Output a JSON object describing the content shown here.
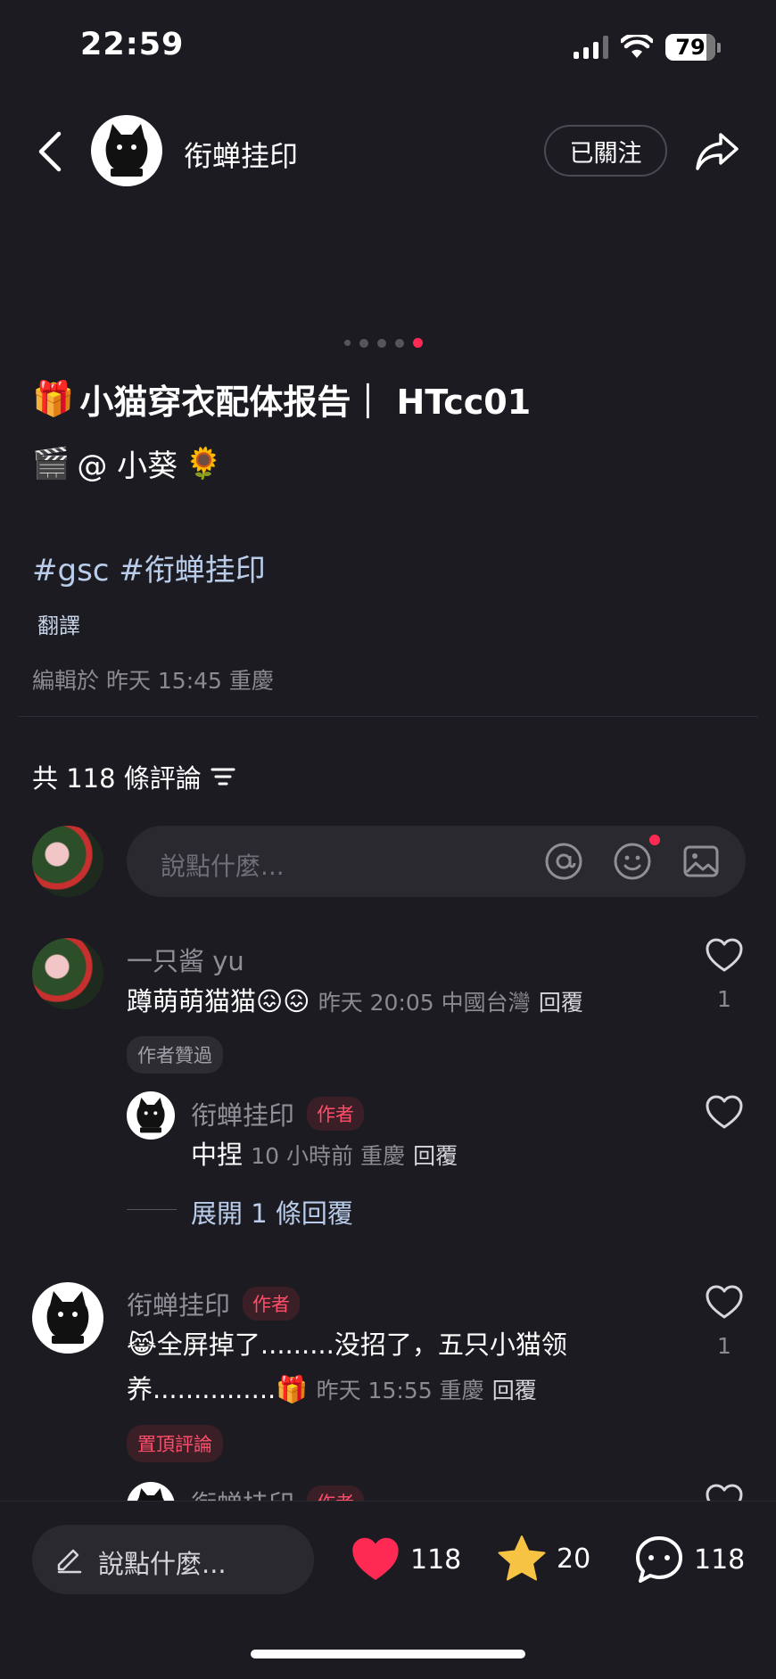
{
  "status_bar": {
    "time": "22:59",
    "battery": "79"
  },
  "header": {
    "account_name": "衔蝉挂印",
    "follow_label": "已關注"
  },
  "post": {
    "title_emoji": "🎁",
    "title": "小猫穿衣配体报告｜ HTcc01",
    "credit_emoji": "🎬",
    "credit": "@ 小葵",
    "credit_end_emoji": "🌻",
    "hashtags": "#gsc #衔蝉挂印",
    "translate_label": "翻譯",
    "edited": "編輯於 昨天 15:45 重慶"
  },
  "comments_header": {
    "title": "共 118 條評論"
  },
  "comment_input": {
    "placeholder": "說點什麼..."
  },
  "comments": [
    {
      "name": "一只酱 yu",
      "text": "蹲萌萌猫猫",
      "emoji": "😖😖",
      "meta": "昨天 20:05 中國台灣",
      "reply": "回覆",
      "tag": "作者贊過",
      "likes": "1"
    },
    {
      "name": "衔蝉挂印",
      "badge": "作者",
      "text": "中捏",
      "meta": "10 小時前 重慶",
      "reply": "回覆",
      "expand": "展開 1 條回覆"
    },
    {
      "name": "衔蝉挂印",
      "badge": "作者",
      "emoji_lead": "😹",
      "text_line1": "全屏掉了.........没招了，五只小猫领",
      "text_line2": "养...............",
      "emoji_end": "🎁",
      "meta": "昨天 15:55 重慶",
      "reply": "回覆",
      "tag": "置頂評論",
      "likes": "1"
    },
    {
      "name": "衔蝉挂印",
      "badge": "作者"
    }
  ],
  "bottom_bar": {
    "placeholder": "說點什麼...",
    "likes": "118",
    "stars": "20",
    "comments": "118"
  },
  "colors": {
    "accent": "#ff2a54",
    "background": "#1c1b22",
    "star": "#f6c343"
  }
}
